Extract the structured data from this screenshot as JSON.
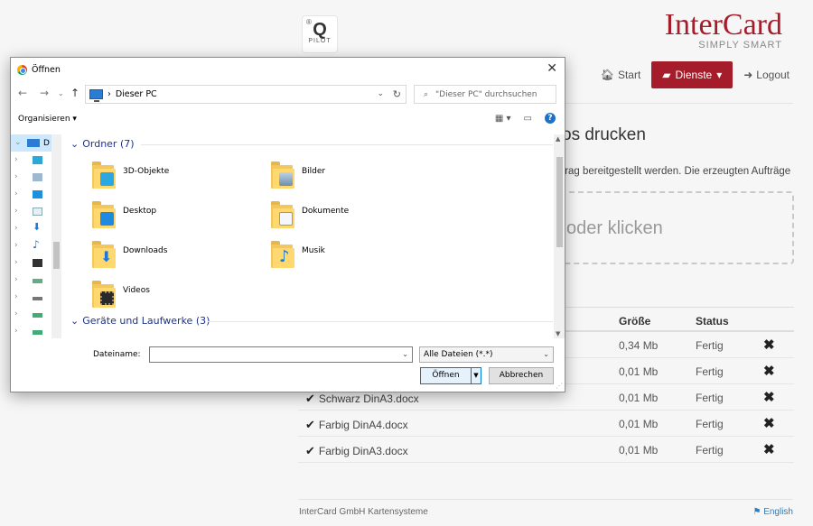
{
  "page": {
    "logo_q": {
      "mark": "®",
      "letter": "Q",
      "sub": "PILOT"
    },
    "brand": {
      "name": "InterCard",
      "tagline": "SIMPLY SMART"
    },
    "nav": {
      "start": "Start",
      "dienste": "Dienste",
      "logout": "Logout"
    },
    "heading_visible": "os drucken",
    "description_visible": "trag bereitgestellt werden. Die erzeugten Aufträge",
    "dropzone_visible": "oder klicken",
    "table": {
      "headers": {
        "size": "Größe",
        "status": "Status"
      },
      "rows": [
        {
          "name": "",
          "size": "0,34 Mb",
          "status": "Fertig"
        },
        {
          "name": "",
          "size": "0,01 Mb",
          "status": "Fertig"
        },
        {
          "name": "Schwarz DinA3.docx",
          "size": "0,01 Mb",
          "status": "Fertig"
        },
        {
          "name": "Farbig DinA4.docx",
          "size": "0,01 Mb",
          "status": "Fertig"
        },
        {
          "name": "Farbig DinA3.docx",
          "size": "0,01 Mb",
          "status": "Fertig"
        }
      ]
    },
    "footer": {
      "company": "InterCard GmbH Kartensysteme",
      "language": "English"
    },
    "colors": {
      "brand_red": "#a51c2a",
      "accent_blue": "#0078d7"
    }
  },
  "dialog": {
    "title": "Öffnen",
    "address": {
      "location": "Dieser PC",
      "search_placeholder": "\"Dieser PC\" durchsuchen"
    },
    "organize": "Organisieren",
    "tree": {
      "selected_label": "D"
    },
    "groups": {
      "folders": "Ordner (7)",
      "drives": "Geräte und Laufwerke (3)"
    },
    "folders": [
      {
        "label": "3D-Objekte",
        "icon": "3d-objects-icon"
      },
      {
        "label": "Bilder",
        "icon": "pictures-icon"
      },
      {
        "label": "Desktop",
        "icon": "desktop-icon"
      },
      {
        "label": "Dokumente",
        "icon": "documents-icon"
      },
      {
        "label": "Downloads",
        "icon": "downloads-icon"
      },
      {
        "label": "Musik",
        "icon": "music-icon"
      },
      {
        "label": "Videos",
        "icon": "videos-icon"
      }
    ],
    "filename_label": "Dateiname:",
    "filename_value": "",
    "filter": "Alle Dateien (*.*)",
    "open_button": "Öffnen",
    "cancel_button": "Abbrechen"
  }
}
